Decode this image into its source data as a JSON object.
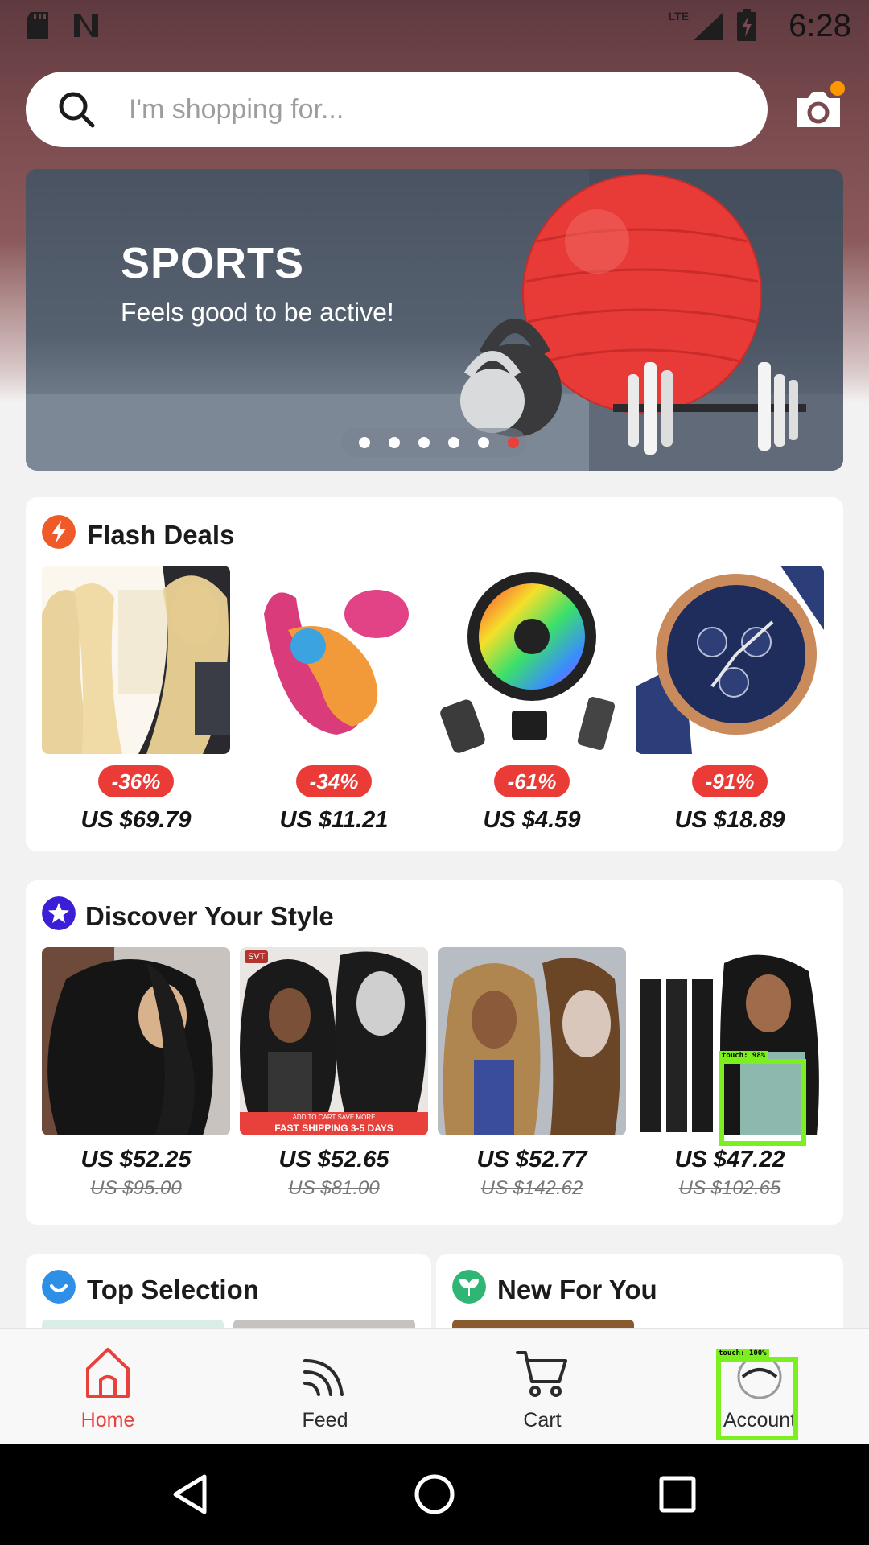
{
  "status_bar": {
    "time": "6:28",
    "network": "LTE"
  },
  "search": {
    "placeholder": "I'm shopping for..."
  },
  "banner": {
    "title": "SPORTS",
    "subtitle": "Feels good to be active!",
    "slide_count": 6,
    "active_slide": 6
  },
  "flash_deals": {
    "title": "Flash Deals",
    "items": [
      {
        "name": "blonde-hair-bundles",
        "discount": "-36%",
        "price": "US $69.79"
      },
      {
        "name": "pink-vibrator",
        "discount": "-34%",
        "price": "US $11.21"
      },
      {
        "name": "rgb-led-strip",
        "discount": "-61%",
        "price": "US $4.59"
      },
      {
        "name": "blue-chronograph-watch",
        "discount": "-91%",
        "price": "US $18.89"
      }
    ]
  },
  "discover": {
    "title": "Discover Your Style",
    "items": [
      {
        "name": "curly-lace-wig",
        "price": "US $52.25",
        "old_price": "US $95.00"
      },
      {
        "name": "deep-wave-wig",
        "price": "US $52.65",
        "old_price": "US $81.00",
        "ribbon": "FAST SHIPPING 3-5 DAYS",
        "ribbon_top": "ADD TO CART SAVE MORE",
        "brand": "SVT"
      },
      {
        "name": "highlight-straight-wig",
        "price": "US $52.77",
        "old_price": "US $142.62"
      },
      {
        "name": "deep-wave-bundles",
        "price": "US $47.22",
        "old_price": "US $102.65"
      }
    ]
  },
  "sections": {
    "top_selection": "Top Selection",
    "new_for_you": "New For You"
  },
  "nav": {
    "home": "Home",
    "feed": "Feed",
    "cart": "Cart",
    "account": "Account"
  },
  "overlays": {
    "touch_1": "touch: 98%",
    "touch_2": "touch: 100%"
  },
  "colors": {
    "accent": "#e8413c",
    "flash_icon": "#f05a28",
    "discover_icon": "#3b1fd6",
    "top_sel_icon": "#2e8fe6",
    "new_icon": "#2fb574"
  }
}
